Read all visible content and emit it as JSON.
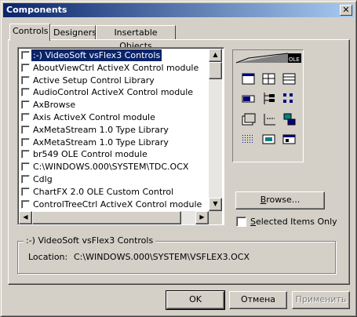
{
  "window": {
    "title": "Components",
    "close_glyph": "✕"
  },
  "tabs": [
    {
      "label": "Controls",
      "active": true
    },
    {
      "label": "Designers",
      "active": false
    },
    {
      "label": "Insertable Objects",
      "active": false
    }
  ],
  "controls_list": {
    "items": [
      {
        "label": ":-) VideoSoft vsFlex3 Controls",
        "checked": false,
        "selected": true
      },
      {
        "label": "AboutViewCtrl ActiveX Control module",
        "checked": false
      },
      {
        "label": "Active Setup Control Library",
        "checked": false
      },
      {
        "label": "AudioControl ActiveX Control module",
        "checked": false
      },
      {
        "label": "AxBrowse",
        "checked": false
      },
      {
        "label": "Axis ActiveX Control module",
        "checked": false
      },
      {
        "label": "AxMetaStream 1.0 Type Library",
        "checked": false
      },
      {
        "label": "AxMetaStream 1.0 Type Library",
        "checked": false
      },
      {
        "label": "br549 OLE Control module",
        "checked": false
      },
      {
        "label": "C:\\WINDOWS.000\\SYSTEM\\TDC.OCX",
        "checked": false
      },
      {
        "label": "Cdlg",
        "checked": false
      },
      {
        "label": "ChartFX 2.0 OLE Custom Control",
        "checked": false
      },
      {
        "label": "ControlTreeCtrl ActiveX Control module",
        "checked": false
      }
    ]
  },
  "palette": {
    "icons": [
      "toolbox-header-icon",
      "ole-icon",
      "calendar-icon",
      "grid-icon",
      "table-icon",
      "progress-icon",
      "tree-icon",
      "list-icon",
      "tabstrip-icon",
      "chart-icon",
      "network-icon",
      "dots-icon",
      "image-icon",
      "form-icon"
    ],
    "ole_text": "OLE"
  },
  "browse_button": {
    "label": "Browse...",
    "accel": "B",
    "rest": "rowse..."
  },
  "selected_only": {
    "label": "Selected Items Only",
    "accel": "S",
    "rest": "elected Items Only",
    "checked": false
  },
  "info_group": {
    "legend": ":-) VideoSoft vsFlex3 Controls",
    "location_label": "Location:",
    "location_value": "C:\\WINDOWS.000\\SYSTEM\\VSFLEX3.OCX"
  },
  "buttons": {
    "ok": "OK",
    "cancel": "Отмена",
    "apply": "Применить"
  },
  "colors": {
    "title_start": "#0a246a",
    "title_end": "#a6caf0",
    "selection": "#0a246a",
    "face": "#d4d0c8"
  }
}
